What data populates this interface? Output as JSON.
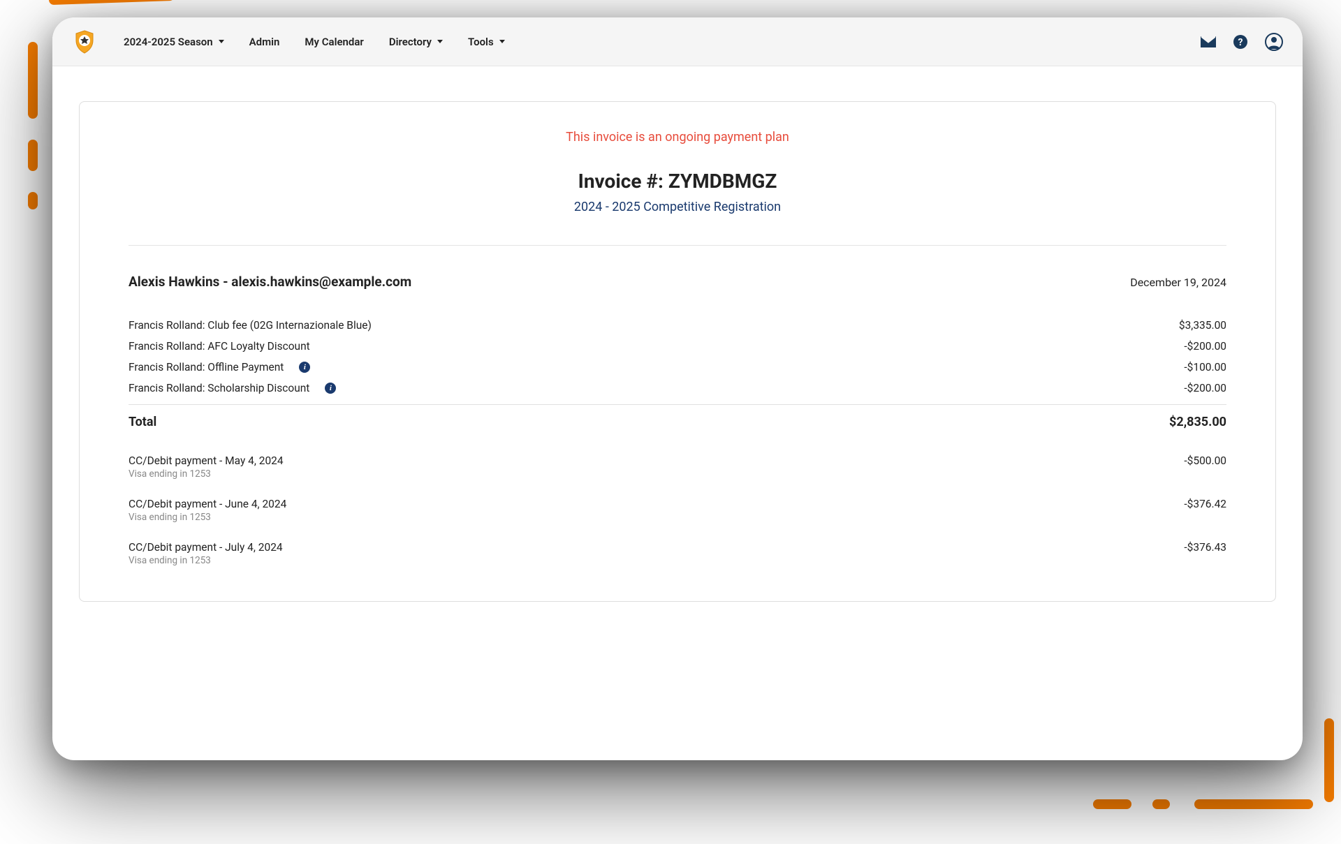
{
  "nav": {
    "season": "2024-2025 Season",
    "admin": "Admin",
    "calendar": "My Calendar",
    "directory": "Directory",
    "tools": "Tools"
  },
  "invoice": {
    "banner": "This invoice is an ongoing payment plan",
    "title": "Invoice #: ZYMDBMGZ",
    "subtitle": "2024 - 2025 Competitive Registration",
    "customer": "Alexis Hawkins - alexis.hawkins@example.com",
    "date": "December 19, 2024",
    "lines": [
      {
        "label": "Francis Rolland: Club fee (02G Internazionale Blue)",
        "amount": "$3,335.00",
        "info": false
      },
      {
        "label": "Francis Rolland: AFC Loyalty Discount",
        "amount": "-$200.00",
        "info": false
      },
      {
        "label": "Francis Rolland: Offline Payment",
        "amount": "-$100.00",
        "info": true
      },
      {
        "label": "Francis Rolland: Scholarship Discount",
        "amount": "-$200.00",
        "info": true
      }
    ],
    "total_label": "Total",
    "total_amount": "$2,835.00",
    "payments": [
      {
        "title": "CC/Debit payment - May 4, 2024",
        "sub": "Visa ending in 1253",
        "amount": "-$500.00"
      },
      {
        "title": "CC/Debit payment - June 4, 2024",
        "sub": "Visa ending in 1253",
        "amount": "-$376.42"
      },
      {
        "title": "CC/Debit payment - July 4, 2024",
        "sub": "Visa ending in 1253",
        "amount": "-$376.43"
      }
    ]
  }
}
